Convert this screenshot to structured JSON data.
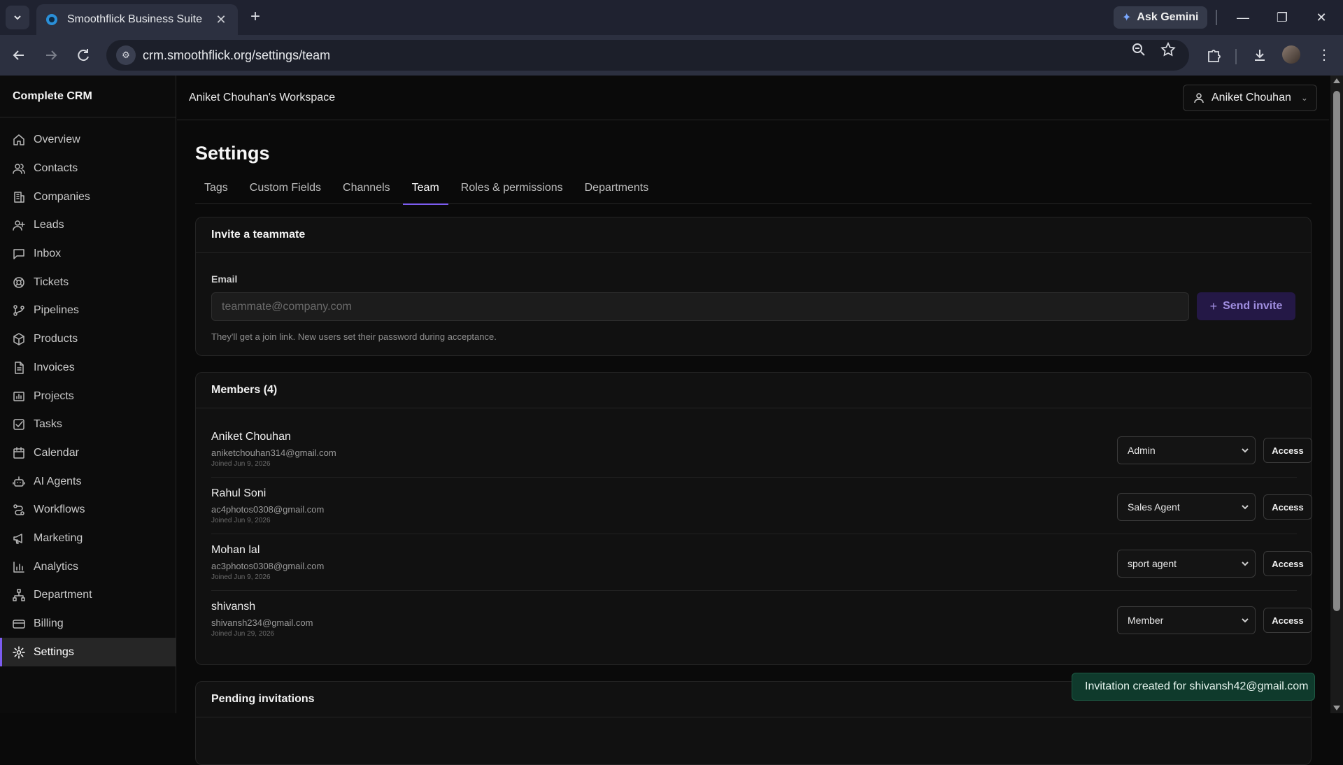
{
  "browser": {
    "tab_title": "Smoothflick Business Suite",
    "tab_close": "✕",
    "new_tab": "+",
    "ask_gemini": "Ask Gemini",
    "url": "crm.smoothflick.org/settings/team",
    "window": {
      "minimize": "—",
      "restore": "❐",
      "close": "✕"
    }
  },
  "app": {
    "brand": "Complete CRM",
    "workspace": "Aniket Chouhan's Workspace",
    "user_menu": "Aniket Chouhan"
  },
  "sidebar": {
    "items": [
      {
        "label": "Overview",
        "icon": "home-icon"
      },
      {
        "label": "Contacts",
        "icon": "users-icon"
      },
      {
        "label": "Companies",
        "icon": "building-icon"
      },
      {
        "label": "Leads",
        "icon": "user-plus-icon"
      },
      {
        "label": "Inbox",
        "icon": "message-icon"
      },
      {
        "label": "Tickets",
        "icon": "lifebuoy-icon"
      },
      {
        "label": "Pipelines",
        "icon": "git-branch-icon"
      },
      {
        "label": "Products",
        "icon": "box-icon"
      },
      {
        "label": "Invoices",
        "icon": "file-icon"
      },
      {
        "label": "Projects",
        "icon": "chart-folder-icon"
      },
      {
        "label": "Tasks",
        "icon": "check-square-icon"
      },
      {
        "label": "Calendar",
        "icon": "calendar-icon"
      },
      {
        "label": "AI Agents",
        "icon": "bot-icon"
      },
      {
        "label": "Workflows",
        "icon": "workflow-icon"
      },
      {
        "label": "Marketing",
        "icon": "megaphone-icon"
      },
      {
        "label": "Analytics",
        "icon": "bar-chart-icon"
      },
      {
        "label": "Department",
        "icon": "network-icon"
      },
      {
        "label": "Billing",
        "icon": "credit-card-icon"
      },
      {
        "label": "Settings",
        "icon": "gear-icon",
        "active": true
      }
    ]
  },
  "page": {
    "title": "Settings",
    "tabs": [
      {
        "label": "Tags"
      },
      {
        "label": "Custom Fields"
      },
      {
        "label": "Channels"
      },
      {
        "label": "Team",
        "active": true
      },
      {
        "label": "Roles & permissions"
      },
      {
        "label": "Departments"
      }
    ]
  },
  "invite": {
    "heading": "Invite a teammate",
    "email_label": "Email",
    "email_placeholder": "teammate@company.com",
    "email_value": "",
    "send_label": "Send invite",
    "hint": "They'll get a join link. New users set their password during acceptance."
  },
  "members": {
    "heading": "Members (4)",
    "access_label": "Access",
    "rows": [
      {
        "name": "Aniket Chouhan",
        "email": "aniketchouhan314@gmail.com",
        "joined": "Joined Jun 9, 2026",
        "role": "Admin"
      },
      {
        "name": "Rahul Soni",
        "email": "ac4photos0308@gmail.com",
        "joined": "Joined Jun 9, 2026",
        "role": "Sales Agent"
      },
      {
        "name": "Mohan lal",
        "email": "ac3photos0308@gmail.com",
        "joined": "Joined Jun 9, 2026",
        "role": "sport agent"
      },
      {
        "name": "shivansh",
        "email": "shivansh234@gmail.com",
        "joined": "Joined Jun 29, 2026",
        "role": "Member"
      }
    ]
  },
  "pending": {
    "heading": "Pending invitations"
  },
  "toast": {
    "message": "Invitation created for shivansh42@gmail.com"
  },
  "colors": {
    "accent": "#7c5cf0",
    "toast_bg": "#0f3a2c",
    "send_button_bg": "#241846"
  }
}
